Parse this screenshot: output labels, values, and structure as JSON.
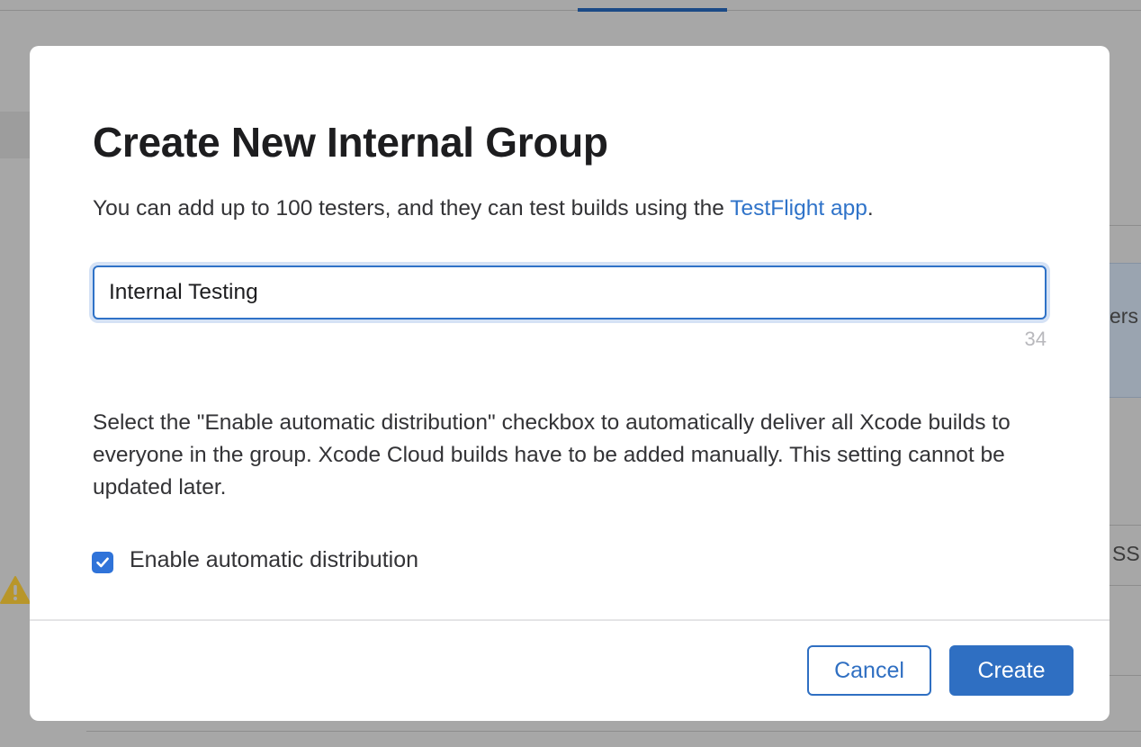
{
  "background": {
    "fragments": {
      "right_row_text": "ers",
      "right_lower_text": "SS"
    },
    "icons": {
      "warning": "warning-triangle-icon"
    }
  },
  "dialog": {
    "title": "Create New Internal Group",
    "description_before_link": "You can add up to 100 testers, and they can test builds using the ",
    "description_link": "TestFlight app",
    "description_after_link": ".",
    "group_name_input": {
      "value": "Internal Testing",
      "remaining_characters": "34"
    },
    "help_text": "Select the \"Enable automatic distribution\" checkbox to automatically deliver all Xcode builds to everyone in the group. Xcode Cloud builds have to be added manually. This setting cannot be updated later.",
    "auto_distribution": {
      "label": "Enable automatic distribution",
      "checked": true,
      "icon": "checkmark-icon"
    },
    "buttons": {
      "cancel": "Cancel",
      "create": "Create"
    }
  },
  "colors": {
    "accent": "#2f6fc2",
    "overlay": "#a7a7a7",
    "warning": "#b8962a"
  }
}
